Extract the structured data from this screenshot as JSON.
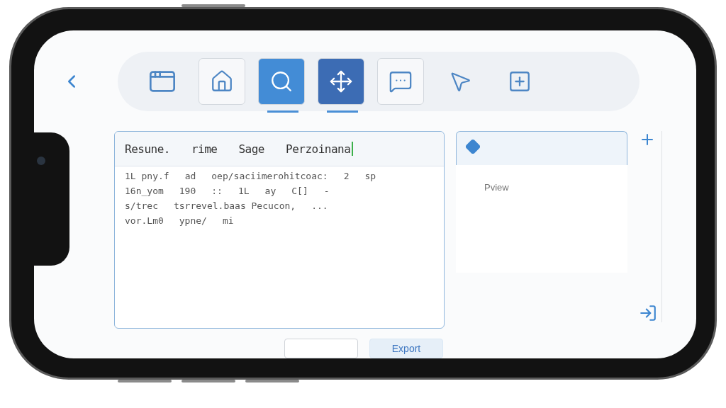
{
  "toolbar": {
    "items": [
      {
        "framed": false,
        "selected": false
      },
      {
        "framed": true,
        "selected": false
      },
      {
        "framed": true,
        "selected": true
      },
      {
        "framed": true,
        "selected": true
      },
      {
        "framed": true,
        "selected": false
      },
      {
        "framed": false,
        "selected": false
      },
      {
        "framed": false,
        "selected": false
      }
    ]
  },
  "table": {
    "columns": [
      "Resune.",
      "rime",
      "Sage",
      "Perzoinana"
    ],
    "rows": [
      [
        "1L pny.f",
        "ad",
        "oep/saciimerohitcoac:",
        "2",
        "sp"
      ],
      [
        "16n_yom",
        "190",
        "::",
        "1L",
        "ay",
        "C[]",
        "-"
      ],
      [
        "s/trec",
        "tsrrevel.baas Pecucon,",
        "..."
      ],
      [
        "vor.Lm0",
        "ypne/",
        "mi"
      ]
    ]
  },
  "preview": {
    "label": "Pview"
  },
  "buttons": [
    {
      "kind": "outline"
    },
    {
      "label": "Export",
      "kind": "primary"
    }
  ]
}
